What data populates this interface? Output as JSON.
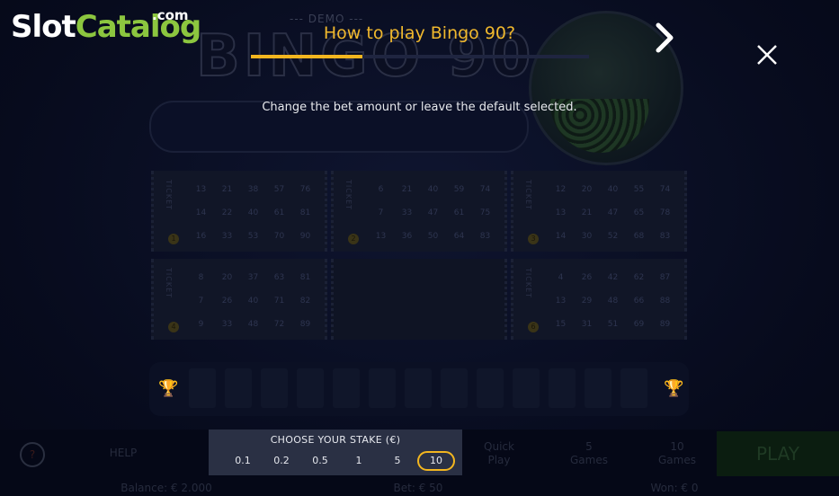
{
  "site_logo": {
    "part1": "Slot",
    "part2": "Catalog",
    "suffix": ".com"
  },
  "tutorial": {
    "title": "How to play Bingo 90?",
    "progress": 0.33,
    "instruction": "Change the bet amount or leave the default selected.",
    "accent_color": "#f3b61f"
  },
  "game_bg": {
    "demo_tag": "--- DEMO ---",
    "logo_text": "BINGO 90",
    "tickets": [
      {
        "label": "TICKET",
        "number": "1",
        "cells": [
          "13",
          "21",
          "38",
          "57",
          "76",
          "14",
          "22",
          "40",
          "61",
          "81",
          "16",
          "33",
          "53",
          "70",
          "90"
        ]
      },
      {
        "label": "TICKET",
        "number": "2",
        "cells": [
          "6",
          "21",
          "40",
          "59",
          "74",
          "7",
          "33",
          "47",
          "61",
          "75",
          "13",
          "36",
          "50",
          "64",
          "83"
        ]
      },
      {
        "label": "TICKET",
        "number": "3",
        "cells": [
          "12",
          "20",
          "40",
          "55",
          "74",
          "13",
          "21",
          "47",
          "65",
          "78",
          "14",
          "30",
          "52",
          "68",
          "83"
        ]
      },
      {
        "label": "TICKET",
        "number": "4",
        "cells": [
          "8",
          "20",
          "37",
          "63",
          "81",
          "7",
          "26",
          "40",
          "71",
          "82",
          "9",
          "33",
          "48",
          "72",
          "89"
        ]
      },
      {
        "label": "",
        "number": "",
        "cells": []
      },
      {
        "label": "TICKET",
        "number": "6",
        "cells": [
          "4",
          "26",
          "42",
          "62",
          "87",
          "13",
          "29",
          "48",
          "66",
          "88",
          "15",
          "31",
          "51",
          "69",
          "89"
        ]
      }
    ],
    "bottom": {
      "help": "HELP",
      "quick_play": "Quick\nPlay",
      "five_games": "5\nGames",
      "ten_games": "10\nGames",
      "play": "PLAY",
      "balance": "Balance: € 2.000",
      "bet": "Bet: € 50",
      "won": "Won: € 0"
    }
  },
  "stake": {
    "title": "CHOOSE YOUR STAKE (€)",
    "options": [
      "0.1",
      "0.2",
      "0.5",
      "1",
      "5",
      "10"
    ],
    "selected": "10"
  }
}
